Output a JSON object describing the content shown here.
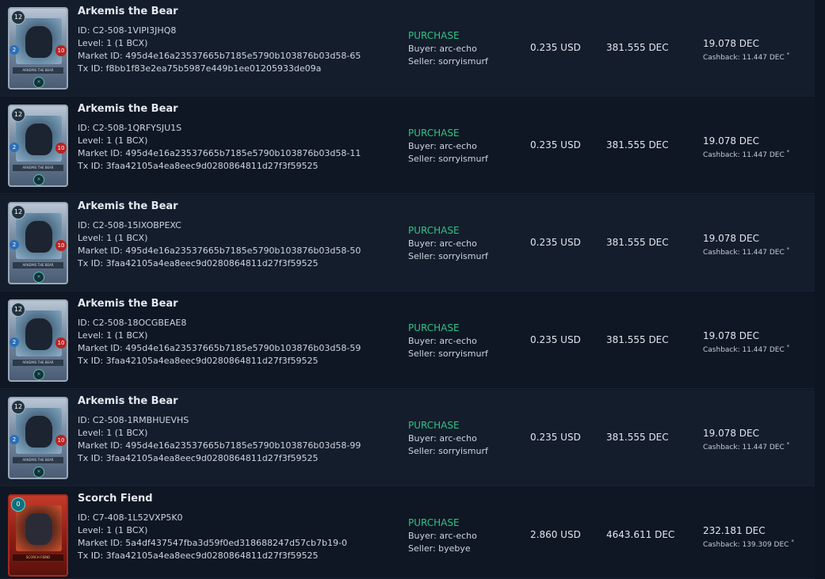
{
  "rows": [
    {
      "card": {
        "name": "Arkemis the Bear",
        "mana": "12",
        "left_stat": "2",
        "right_stat": "10",
        "banner": "ARKEMIS THE BEAR",
        "theme": "water"
      },
      "name": "Arkemis the Bear",
      "id": "ID: C2-508-1VIPI3JHQ8",
      "level": "Level: 1 (1 BCX)",
      "market_id": "Market ID: 495d4e16a23537665b7185e5790b103876b03d58-65",
      "tx_id": "Tx ID: f8bb1f83e2ea75b5987e449b1ee01205933de09a",
      "type": "PURCHASE",
      "buyer": "Buyer: arc-echo",
      "seller": "Seller: sorryismurf",
      "usd": "0.235 USD",
      "dec": "381.555 DEC",
      "fee": "19.078 DEC",
      "cashback": "Cashback: 11.447 DEC"
    },
    {
      "card": {
        "name": "Arkemis the Bear",
        "mana": "12",
        "left_stat": "2",
        "right_stat": "10",
        "banner": "ARKEMIS THE BEAR",
        "theme": "water"
      },
      "name": "Arkemis the Bear",
      "id": "ID: C2-508-1QRFYSJU1S",
      "level": "Level: 1 (1 BCX)",
      "market_id": "Market ID: 495d4e16a23537665b7185e5790b103876b03d58-11",
      "tx_id": "Tx ID: 3faa42105a4ea8eec9d0280864811d27f3f59525",
      "type": "PURCHASE",
      "buyer": "Buyer: arc-echo",
      "seller": "Seller: sorryismurf",
      "usd": "0.235 USD",
      "dec": "381.555 DEC",
      "fee": "19.078 DEC",
      "cashback": "Cashback: 11.447 DEC"
    },
    {
      "card": {
        "name": "Arkemis the Bear",
        "mana": "12",
        "left_stat": "2",
        "right_stat": "10",
        "banner": "ARKEMIS THE BEAR",
        "theme": "water"
      },
      "name": "Arkemis the Bear",
      "id": "ID: C2-508-15IXOBPEXC",
      "level": "Level: 1 (1 BCX)",
      "market_id": "Market ID: 495d4e16a23537665b7185e5790b103876b03d58-50",
      "tx_id": "Tx ID: 3faa42105a4ea8eec9d0280864811d27f3f59525",
      "type": "PURCHASE",
      "buyer": "Buyer: arc-echo",
      "seller": "Seller: sorryismurf",
      "usd": "0.235 USD",
      "dec": "381.555 DEC",
      "fee": "19.078 DEC",
      "cashback": "Cashback: 11.447 DEC"
    },
    {
      "card": {
        "name": "Arkemis the Bear",
        "mana": "12",
        "left_stat": "2",
        "right_stat": "10",
        "banner": "ARKEMIS THE BEAR",
        "theme": "water"
      },
      "name": "Arkemis the Bear",
      "id": "ID: C2-508-18OCGBEAE8",
      "level": "Level: 1 (1 BCX)",
      "market_id": "Market ID: 495d4e16a23537665b7185e5790b103876b03d58-59",
      "tx_id": "Tx ID: 3faa42105a4ea8eec9d0280864811d27f3f59525",
      "type": "PURCHASE",
      "buyer": "Buyer: arc-echo",
      "seller": "Seller: sorryismurf",
      "usd": "0.235 USD",
      "dec": "381.555 DEC",
      "fee": "19.078 DEC",
      "cashback": "Cashback: 11.447 DEC"
    },
    {
      "card": {
        "name": "Arkemis the Bear",
        "mana": "12",
        "left_stat": "2",
        "right_stat": "10",
        "banner": "ARKEMIS THE BEAR",
        "theme": "water"
      },
      "name": "Arkemis the Bear",
      "id": "ID: C2-508-1RMBHUEVHS",
      "level": "Level: 1 (1 BCX)",
      "market_id": "Market ID: 495d4e16a23537665b7185e5790b103876b03d58-99",
      "tx_id": "Tx ID: 3faa42105a4ea8eec9d0280864811d27f3f59525",
      "type": "PURCHASE",
      "buyer": "Buyer: arc-echo",
      "seller": "Seller: sorryismurf",
      "usd": "0.235 USD",
      "dec": "381.555 DEC",
      "fee": "19.078 DEC",
      "cashback": "Cashback: 11.447 DEC"
    },
    {
      "card": {
        "name": "Scorch Fiend",
        "mana": "0",
        "left_stat": "",
        "right_stat": "",
        "banner": "SCORCH FIEND",
        "theme": "fire"
      },
      "name": "Scorch Fiend",
      "id": "ID: C7-408-1L52VXP5K0",
      "level": "Level: 1 (1 BCX)",
      "market_id": "Market ID: 5a4df437547fba3d59f0ed318688247d57cb7b19-0",
      "tx_id": "Tx ID: 3faa42105a4ea8eec9d0280864811d27f3f59525",
      "type": "PURCHASE",
      "buyer": "Buyer: arc-echo",
      "seller": "Seller: byebye",
      "usd": "2.860 USD",
      "dec": "4643.611 DEC",
      "fee": "232.181 DEC",
      "cashback": "Cashback: 139.309 DEC"
    }
  ],
  "colors": {
    "purchase": "#2fc386",
    "row_odd": "#141d2c",
    "row_even": "#0f1724"
  }
}
